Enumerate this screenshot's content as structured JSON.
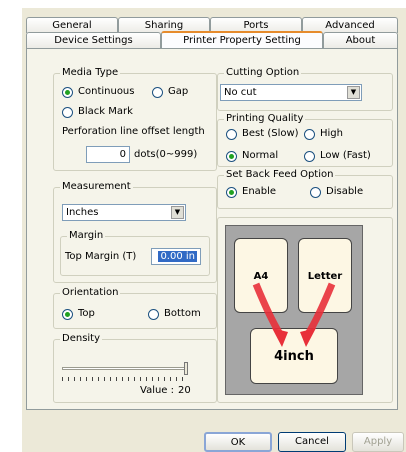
{
  "tabs_row1": [
    "General",
    "Sharing",
    "Ports",
    "Advanced"
  ],
  "tabs_row2": [
    "Device Settings",
    "Printer Property Setting",
    "About"
  ],
  "media": {
    "title": "Media Type",
    "continuous": "Continuous",
    "gap": "Gap",
    "black_mark": "Black Mark",
    "selected": "Continuous",
    "offset_label": "Perforation line offset length",
    "offset_value": "0",
    "offset_unit": "dots(0~999)"
  },
  "measure": {
    "title": "Measurement",
    "value": "Inches",
    "margin_title": "Margin",
    "top_margin_label": "Top Margin (T)",
    "top_margin_value": "0.00 in"
  },
  "orientation": {
    "title": "Orientation",
    "top": "Top",
    "bottom": "Bottom",
    "selected": "Top"
  },
  "density": {
    "title": "Density",
    "value_label": "Value :",
    "value": "20",
    "level": 1.0
  },
  "cutting": {
    "title": "Cutting Option",
    "value": "No cut"
  },
  "quality": {
    "title": "Printing Quality",
    "best": "Best (Slow)",
    "high": "High",
    "normal": "Normal",
    "low": "Low (Fast)",
    "selected": "Normal"
  },
  "backfeed": {
    "title": "Set Back Feed Option",
    "enable": "Enable",
    "disable": "Disable",
    "selected": "Enable"
  },
  "diagram": {
    "a4": "A4",
    "letter": "Letter",
    "inch": "4inch"
  },
  "buttons": {
    "ok": "OK",
    "cancel": "Cancel",
    "apply": "Apply"
  },
  "colors": {
    "arrow": "#e8303a",
    "selection": "#316ac5",
    "tab_accent": "#e68b2c"
  }
}
